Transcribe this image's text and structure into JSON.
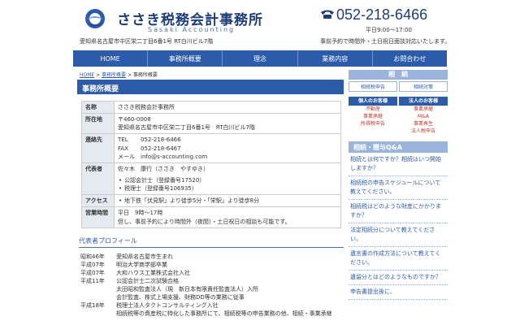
{
  "header": {
    "site_name": "ささき税務会計事務所",
    "site_name_en": "Sasaki Accounting",
    "address": "愛知県名古屋市中区栄二丁目6番1号 RT白川ビル7階",
    "phone": "052-218-6466",
    "hours": "平日9:00～17:00",
    "notice": "事前予約で時間外・土日祝日面談対応いたします。"
  },
  "nav": [
    "HOME",
    "事務所概要",
    "理念",
    "業務内容",
    "お問合わせ"
  ],
  "breadcrumb": {
    "home": "HOME",
    "sep1": " > ",
    "parent": "事務所概要",
    "sep2": " > ",
    "current": "事務所概要"
  },
  "main": {
    "title": "事務所概要",
    "table": {
      "name_label": "名称",
      "name": "ささき税務会計事務所",
      "addr_label": "所在地",
      "zip": "〒460-0008",
      "addr": "愛知県名古屋市中区栄二丁目6番1号　RT白川ビル7階",
      "contact_label": "連絡先",
      "tel_label": "TEL",
      "tel": "052-218-6466",
      "fax_label": "FAX",
      "fax": "052-218-6467",
      "mail_label": "メール",
      "mail": "info@s-accounting.com",
      "rep_label": "代表者",
      "rep": "佐々木　康行（ささき　やすゆき）",
      "rep_q1": "公認会計士（登録番号17520）",
      "rep_q2": "税理士（登録番号106935）",
      "access_label": "アクセス",
      "access": "地下鉄「伏見駅」より徒歩5分・「栄駅」より徒歩8分",
      "hours_label": "営業時間",
      "hours1": "平日　9時～17時",
      "hours2": "但し、事前予約により時間外（夜間）・土日祝日の相談も可能です。"
    },
    "profile_title": "代表者プロフィール",
    "profile": [
      {
        "year": "昭和46年",
        "text": "愛知県名古屋市生まれ"
      },
      {
        "year": "平成07年",
        "text": "明治大学商学部卒業"
      },
      {
        "year": "平成07年",
        "text": "大和ハウス工業株式会社入社"
      },
      {
        "year": "平成11年",
        "text": "公認会計士二次試験合格"
      },
      {
        "year": "",
        "text": "太田昭和監査法人（現　新日本有限責任監査法人）入所"
      },
      {
        "year": "",
        "text": "会計監査、株式上場支援、財務DD等の業務に従事"
      },
      {
        "year": "平成18年",
        "text": "税理士法人タクトコンサルティング入社"
      },
      {
        "year": "",
        "text": "相続税等の資産税に特化した事務所にて、相続税等の申告業務の他、相続・事業承継"
      }
    ]
  },
  "side": {
    "souzoku_head": "相　続",
    "btn1": "相続税申告",
    "btn2": "相続対策",
    "kojin_head": "個人のお客様",
    "kojin_items": [
      "不動産",
      "事業承継",
      "所得税申告"
    ],
    "houjin_head": "法人のお客様",
    "houjin_items": [
      "事業承継",
      "M&A",
      "事業再生",
      "法人税申告"
    ],
    "qa_head": "相続・贈与Q&A",
    "qa": [
      "相続とは何ですか？相続はいつ開始しますか？",
      "相続税の申告スケジュールについて教えてください。",
      "相続税はどのような財産にかかりますか？",
      "法定相続分について教えてください。",
      "遺言書の作成方法について教えてください。",
      "遺留分とはどのようなものですか？",
      "申告書提出後に、"
    ]
  },
  "colors": {
    "primary": "#2c5ba9",
    "light": "#9bb4dc",
    "accent": "#c0392b"
  }
}
